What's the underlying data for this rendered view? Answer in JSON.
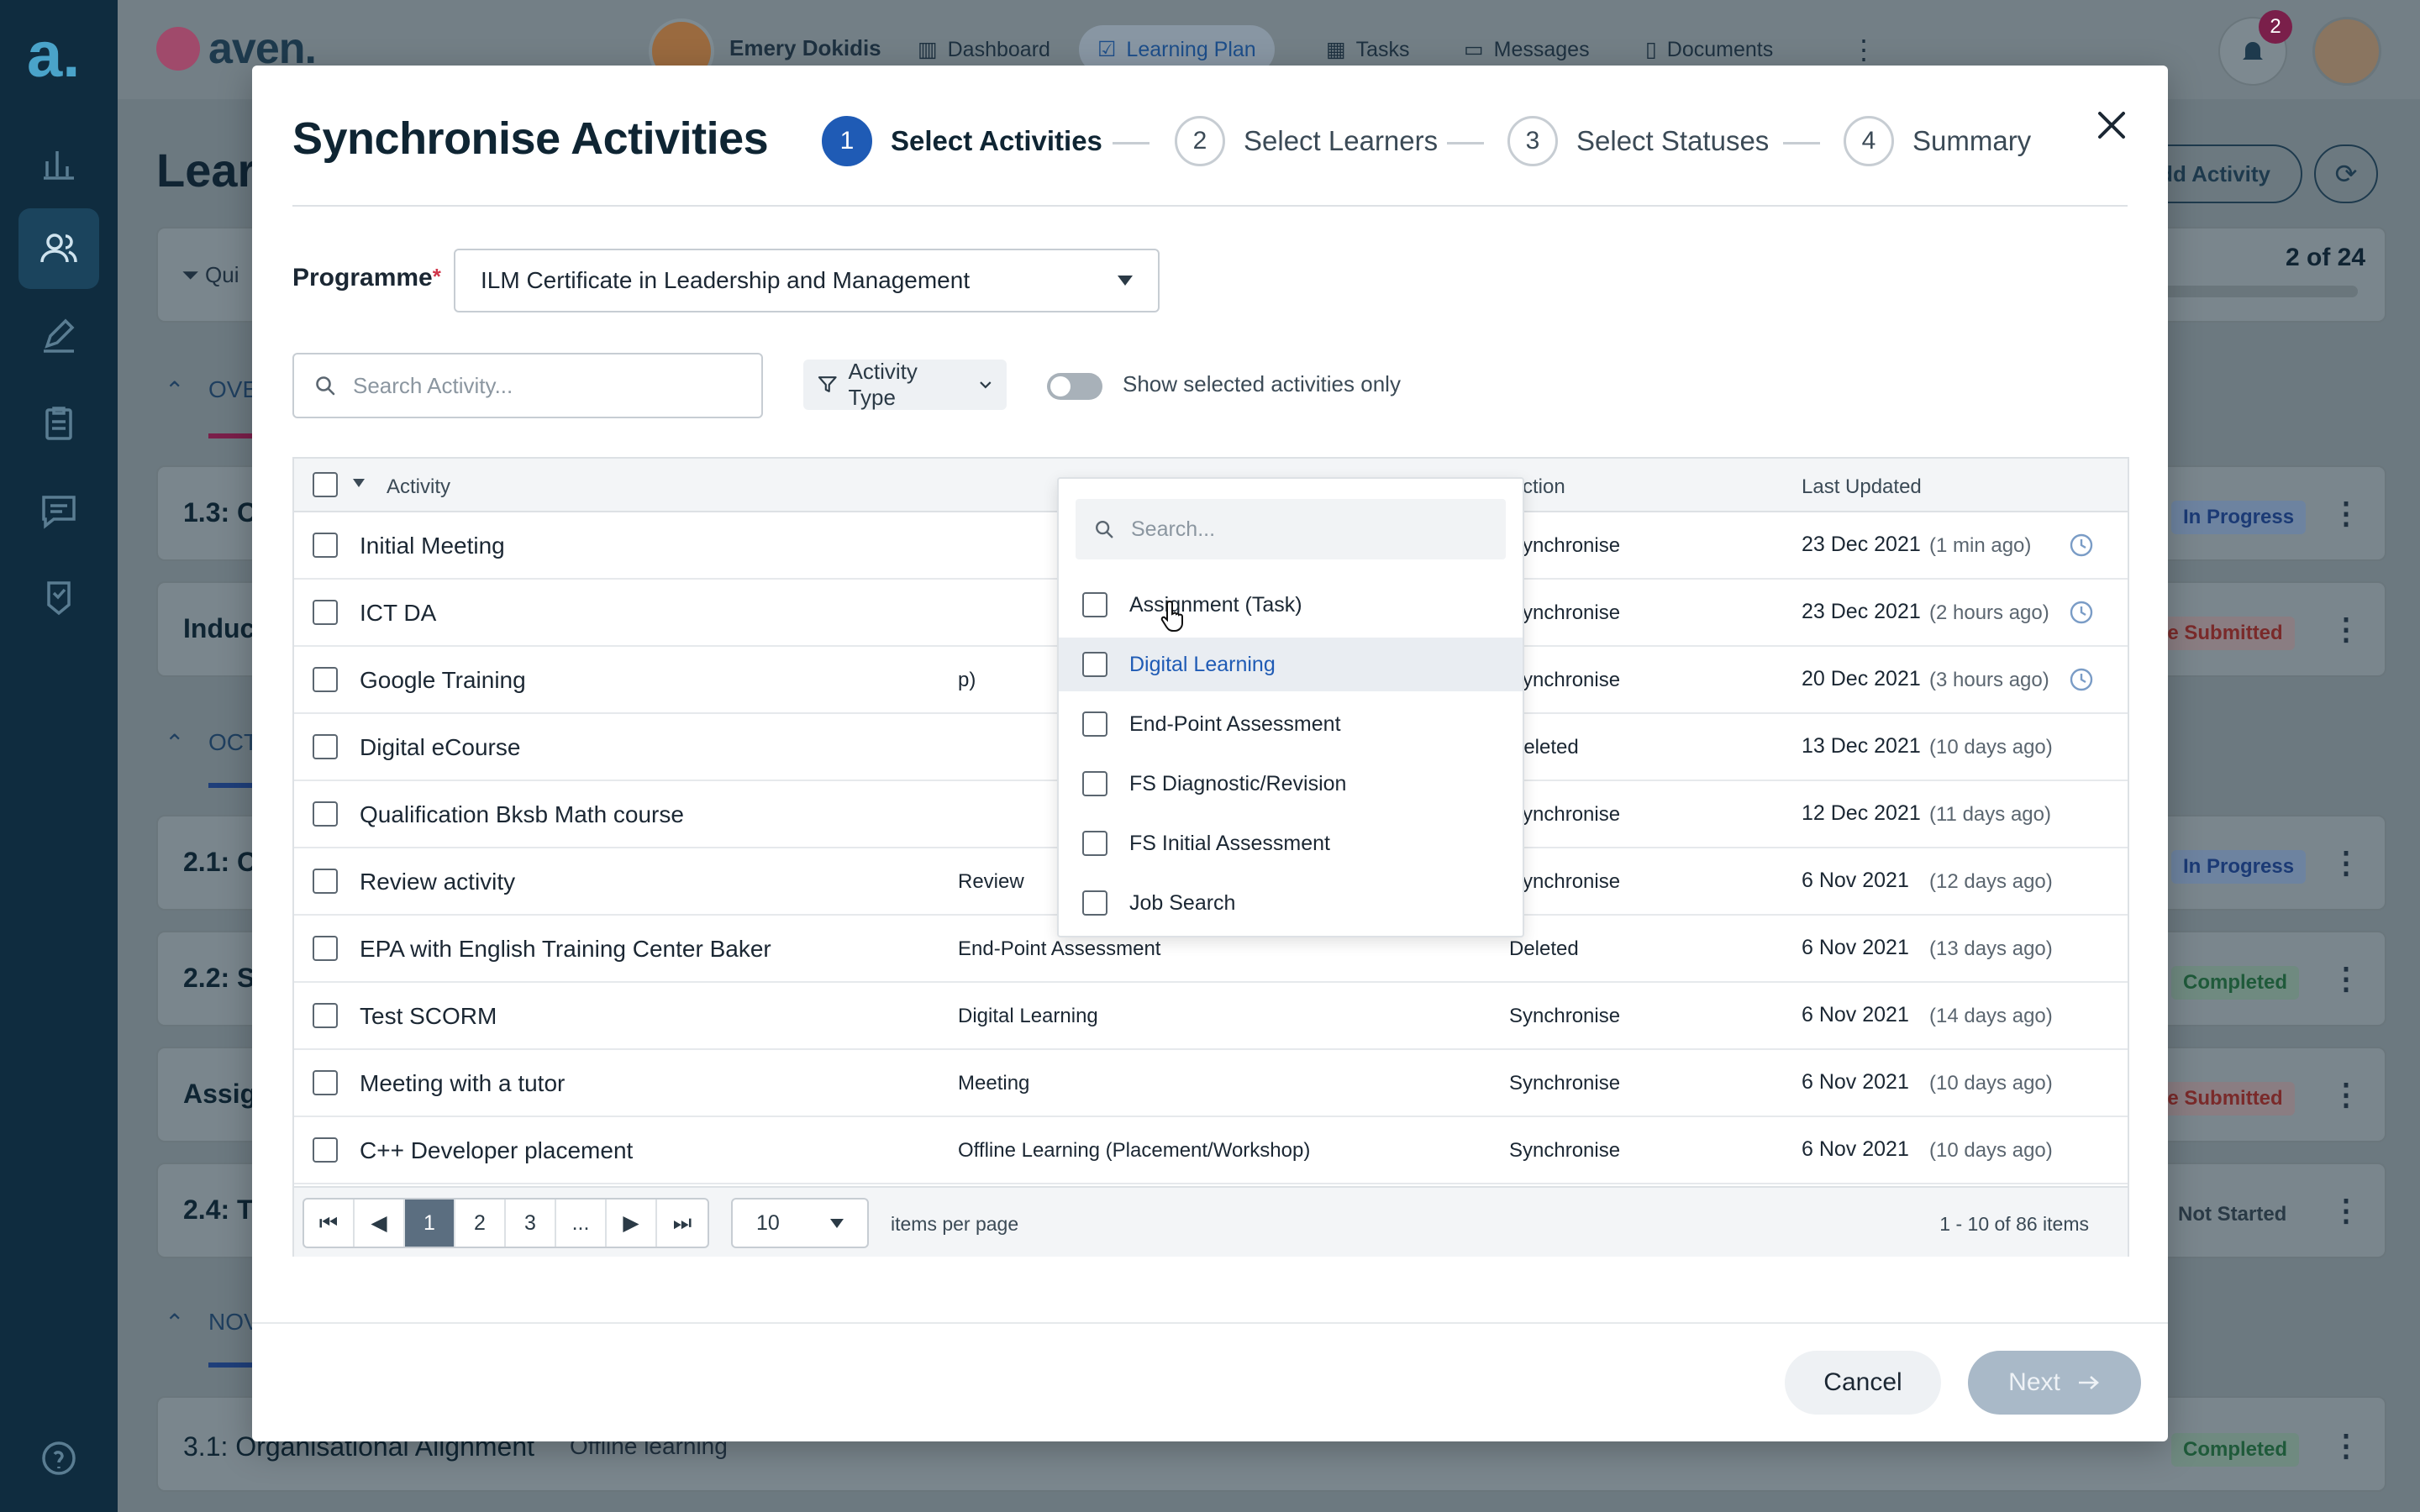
{
  "app": {
    "brand": "aven.",
    "user_name": "Emery Dokidis",
    "nav": [
      "Dashboard",
      "Learning Plan",
      "Tasks",
      "Messages",
      "Documents"
    ],
    "active_nav": "Learning Plan",
    "notification_count": "2"
  },
  "background": {
    "page_title": "Learn",
    "add_activity": "Add Activity",
    "progress": "2 of 24",
    "filter_hint": "Qui",
    "section_overview": "OVE",
    "section_oct": "OCT",
    "section_nov": "NOV",
    "rows": [
      {
        "title": "1.3: O",
        "status": "In Progress"
      },
      {
        "title": "Induc",
        "status": "ce Submitted"
      },
      {
        "title": "2.1: O",
        "status": "In Progress"
      },
      {
        "title": "2.2: S",
        "status": "Completed"
      },
      {
        "title": "Assig",
        "status": "ce Submitted"
      },
      {
        "title": "2.4: T",
        "status": "Not Started"
      },
      {
        "title": "3.1: Organisational Alignment",
        "type": "Offline learning",
        "status": "Completed"
      }
    ]
  },
  "modal": {
    "title": "Synchronise Activities",
    "steps": [
      {
        "num": "1",
        "label": "Select Activities"
      },
      {
        "num": "2",
        "label": "Select Learners"
      },
      {
        "num": "3",
        "label": "Select Statuses"
      },
      {
        "num": "4",
        "label": "Summary"
      }
    ],
    "programme_label": "Programme",
    "programme_required": "*",
    "programme_value": "ILM Certificate in Leadership and Management",
    "search_placeholder": "Search Activity...",
    "filter_label": "Activity Type",
    "toggle_label": "Show selected activities only",
    "columns": {
      "activity": "Activity",
      "action": "Action",
      "last_updated": "Last Updated"
    },
    "rows": [
      {
        "name": "Initial Meeting",
        "type": "",
        "action": "Synchronise",
        "date": "23 Dec 2021",
        "ago": "(1 min ago)",
        "clock": true
      },
      {
        "name": "ICT DA",
        "type": "",
        "action": "Synchronise",
        "date": "23 Dec 2021",
        "ago": "(2 hours ago)",
        "clock": true
      },
      {
        "name": "Google Training",
        "type": "p)",
        "action": "Synchronise",
        "date": "20 Dec 2021",
        "ago": "(3 hours ago)",
        "clock": true
      },
      {
        "name": "Digital eCourse",
        "type": "",
        "action": "Deleted",
        "date": "13 Dec 2021",
        "ago": "(10 days ago)",
        "clock": false
      },
      {
        "name": "Qualification Bksb Math course",
        "type": "",
        "action": "Synchronise",
        "date": "12 Dec 2021",
        "ago": "(11 days ago)",
        "clock": false
      },
      {
        "name": "Review activity",
        "type": "Review",
        "action": "Synchronise",
        "date": "6 Nov 2021",
        "ago": "(12 days ago)",
        "clock": false
      },
      {
        "name": "EPA with English Training Center  Baker",
        "type": "End-Point Assessment",
        "action": "Deleted",
        "date": "6 Nov 2021",
        "ago": "(13 days ago)",
        "clock": false
      },
      {
        "name": "Test SCORM",
        "type": "Digital Learning",
        "action": "Synchronise",
        "date": "6 Nov 2021",
        "ago": "(14 days ago)",
        "clock": false
      },
      {
        "name": "Meeting with a tutor",
        "type": "Meeting",
        "action": "Synchronise",
        "date": "6 Nov 2021",
        "ago": "(10 days ago)",
        "clock": false
      },
      {
        "name": "C++ Developer placement",
        "type": "Offline Learning (Placement/Workshop)",
        "action": "Synchronise",
        "date": "6 Nov 2021",
        "ago": "(10 days ago)",
        "clock": false
      }
    ],
    "pager": {
      "pages": [
        "1",
        "2",
        "3",
        "..."
      ],
      "active_page": "1",
      "per_page": "10",
      "per_page_label": "items per page",
      "count": "1 - 10 of 86 items"
    },
    "cancel": "Cancel",
    "next": "Next"
  },
  "dropdown": {
    "search_placeholder": "Search...",
    "items": [
      "Assignment (Task)",
      "Digital Learning",
      "End-Point Assessment",
      "FS Diagnostic/Revision",
      "FS Initial Assessment",
      "Job Search"
    ],
    "hover_item": "Digital Learning"
  },
  "colors": {
    "primary": "#1f5bb5",
    "sidebar": "#0f2c3f",
    "overlay": "#6c7980"
  }
}
